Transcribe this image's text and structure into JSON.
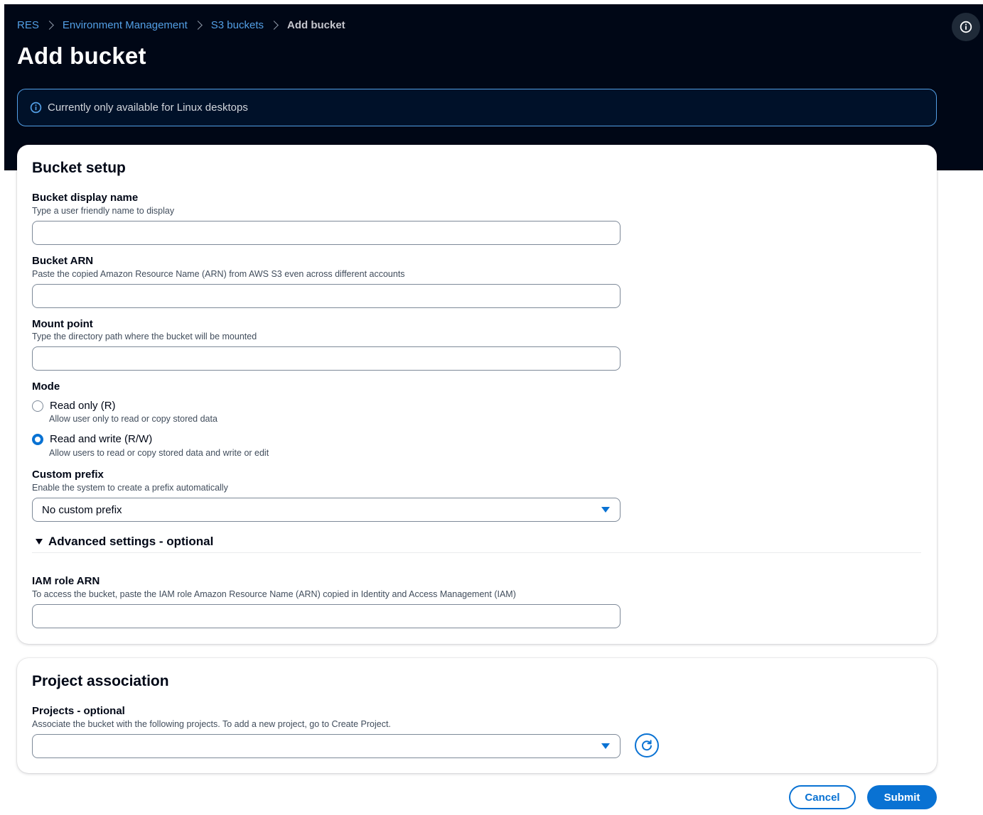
{
  "breadcrumb": {
    "items": [
      "RES",
      "Environment Management",
      "S3 buckets"
    ],
    "current": "Add bucket"
  },
  "page": {
    "title": "Add bucket"
  },
  "alert": {
    "text": "Currently only available for Linux desktops"
  },
  "bucket_setup": {
    "title": "Bucket setup",
    "display_name": {
      "label": "Bucket display name",
      "description": "Type a user friendly name to display",
      "value": ""
    },
    "arn": {
      "label": "Bucket ARN",
      "description": "Paste the copied Amazon Resource Name (ARN) from AWS S3 even across different accounts",
      "value": ""
    },
    "mount_point": {
      "label": "Mount point",
      "description": "Type the directory path where the bucket will be mounted",
      "value": ""
    },
    "mode": {
      "label": "Mode",
      "options": [
        {
          "label": "Read only (R)",
          "description": "Allow user only to read or copy stored data",
          "selected": false
        },
        {
          "label": "Read and write (R/W)",
          "description": "Allow users to read or copy stored data and write or edit",
          "selected": true
        }
      ]
    },
    "custom_prefix": {
      "label": "Custom prefix",
      "description": "Enable the system to create a prefix automatically",
      "selected": "No custom prefix"
    },
    "advanced": {
      "title": "Advanced settings - optional",
      "iam_role": {
        "label": "IAM role ARN",
        "description": "To access the bucket, paste the IAM role Amazon Resource Name (ARN) copied in Identity and Access Management (IAM)",
        "value": ""
      }
    }
  },
  "project_association": {
    "title": "Project association",
    "projects": {
      "label": "Projects - optional",
      "description": "Associate the bucket with the following projects. To add a new project, go to Create Project.",
      "selected": ""
    }
  },
  "actions": {
    "cancel": "Cancel",
    "submit": "Submit"
  },
  "colors": {
    "header_bg": "#000716",
    "link": "#539fe5",
    "primary": "#0972d3"
  }
}
